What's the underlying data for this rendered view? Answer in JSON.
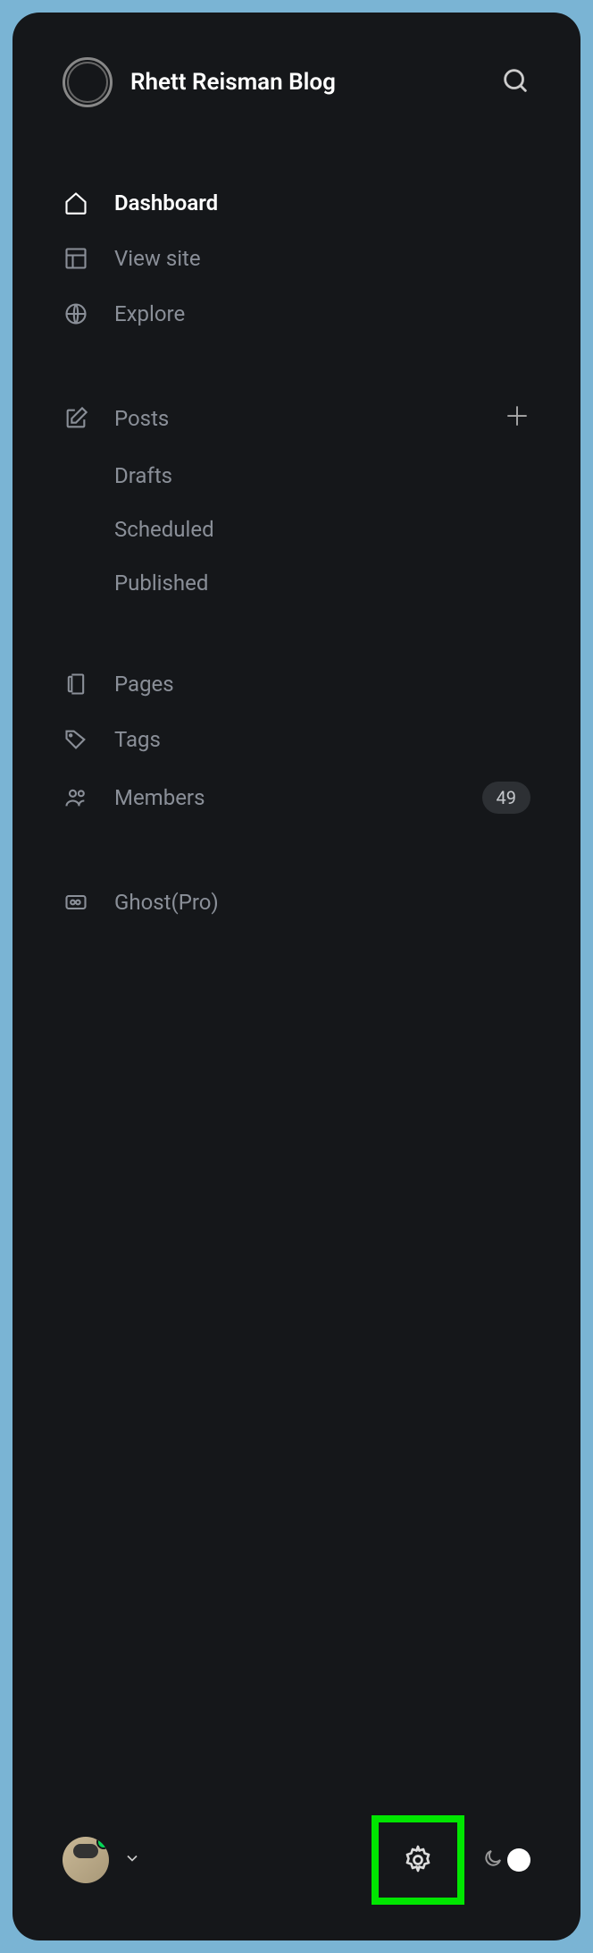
{
  "header": {
    "site_title": "Rhett Reisman Blog"
  },
  "nav_primary": [
    {
      "label": "Dashboard",
      "icon": "home",
      "active": true
    },
    {
      "label": "View site",
      "icon": "layout",
      "active": false
    },
    {
      "label": "Explore",
      "icon": "globe",
      "active": false
    }
  ],
  "posts": {
    "label": "Posts",
    "sub": [
      {
        "label": "Drafts"
      },
      {
        "label": "Scheduled"
      },
      {
        "label": "Published"
      }
    ]
  },
  "nav_content": {
    "pages_label": "Pages",
    "tags_label": "Tags",
    "members_label": "Members",
    "members_count": "49"
  },
  "ghost_pro_label": "Ghost(Pro)"
}
